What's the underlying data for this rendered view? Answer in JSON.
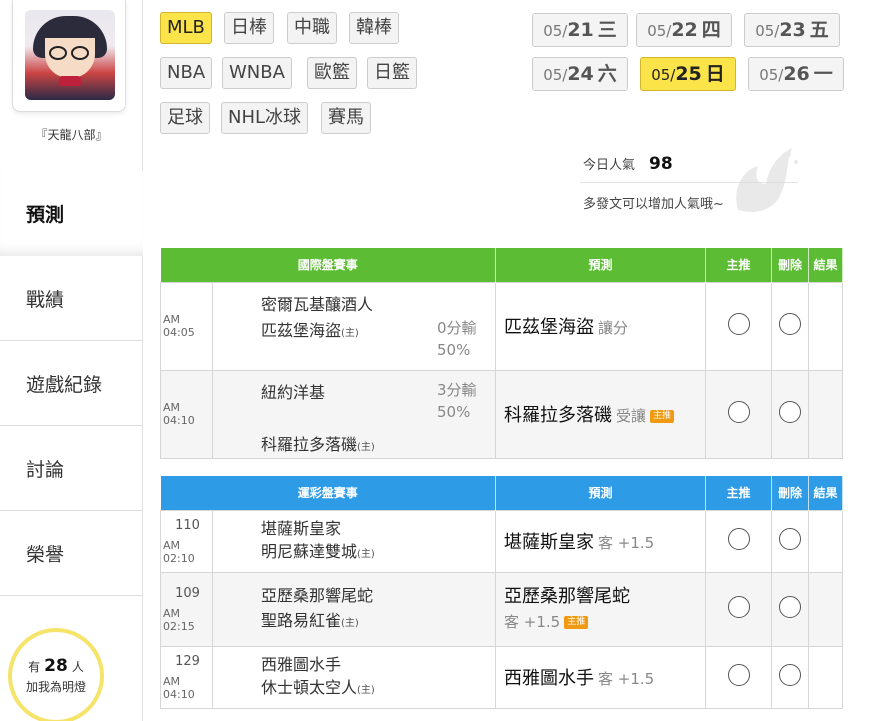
{
  "user": {
    "name": "『天龍八部』"
  },
  "nav": [
    {
      "label": "預測",
      "active": true
    },
    {
      "label": "戰績",
      "active": false
    },
    {
      "label": "遊戲紀錄",
      "active": false
    },
    {
      "label": "討論",
      "active": false
    },
    {
      "label": "榮譽",
      "active": false
    }
  ],
  "fans": {
    "prefix": "有",
    "count": "28",
    "suffix": "人",
    "action": "加我為明燈"
  },
  "sports": [
    {
      "label": "MLB",
      "active": true
    },
    {
      "label": "日棒"
    },
    {
      "label": "中職"
    },
    {
      "label": "韓棒"
    },
    {
      "label": "NBA"
    },
    {
      "label": "WNBA"
    },
    {
      "label": "歐籃"
    },
    {
      "label": "日籃"
    },
    {
      "label": "足球"
    },
    {
      "label": "NHL冰球"
    },
    {
      "label": "賽馬"
    }
  ],
  "dates": [
    {
      "month": "05/",
      "day": "21",
      "weekday": "三"
    },
    {
      "month": "05/",
      "day": "22",
      "weekday": "四"
    },
    {
      "month": "05/",
      "day": "23",
      "weekday": "五"
    },
    {
      "month": "05/",
      "day": "24",
      "weekday": "六"
    },
    {
      "month": "05/",
      "day": "25",
      "weekday": "日",
      "active": true
    },
    {
      "month": "05/",
      "day": "26",
      "weekday": "一"
    }
  ],
  "popularity": {
    "label": "今日人氣",
    "value": "98",
    "hint": "多發文可以增加人氣哦~"
  },
  "intl_table": {
    "headers": [
      "國際盤賽事",
      "預測",
      "主推",
      "刪除",
      "結果"
    ],
    "rows": [
      {
        "time": "AM 04:05",
        "away": "密爾瓦基釀酒人",
        "home": "匹茲堡海盜",
        "home_tag": "(主)",
        "spread": "0分輸",
        "pct": "50%",
        "pick": "匹茲堡海盜",
        "pick_sub": "讓分",
        "featured": ""
      },
      {
        "time": "AM 04:10",
        "away": "紐約洋基",
        "home": "科羅拉多落磯",
        "home_tag": "(主)",
        "spread": "3分輸",
        "pct": "50%",
        "pick": "科羅拉多落磯",
        "pick_sub": "受讓",
        "featured": "主推"
      }
    ]
  },
  "sport_table": {
    "headers": [
      "運彩盤賽事",
      "預測",
      "主推",
      "刪除",
      "結果"
    ],
    "rows": [
      {
        "no": "110",
        "time": "AM 02:10",
        "away": "堪薩斯皇家",
        "home": "明尼蘇達雙城",
        "home_tag": "(主)",
        "pick": "堪薩斯皇家",
        "pick_sub": "客 +1.5",
        "featured": ""
      },
      {
        "no": "109",
        "time": "AM 02:15",
        "away": "亞歷桑那響尾蛇",
        "home": "聖路易紅雀",
        "home_tag": "(主)",
        "pick": "亞歷桑那響尾蛇",
        "pick_sub": "客 +1.5",
        "featured": "主推"
      },
      {
        "no": "129",
        "time": "AM 04:10",
        "away": "西雅圖水手",
        "home": "休士頓太空人",
        "home_tag": "(主)",
        "pick": "西雅圖水手",
        "pick_sub": "客 +1.5",
        "featured": ""
      }
    ]
  },
  "colors": {
    "accent_yellow": "#fbe34a",
    "intl_header": "#5cbd34",
    "sport_header": "#2d9be6",
    "badge": "#f09a12"
  }
}
